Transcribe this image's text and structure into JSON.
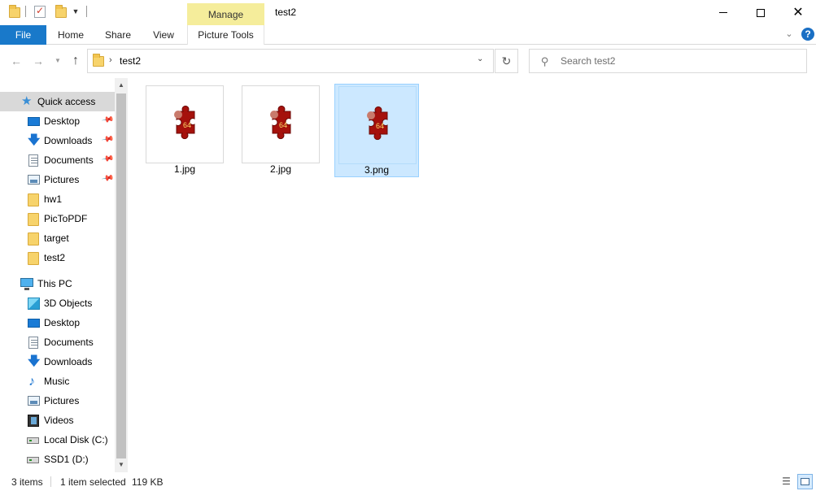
{
  "window": {
    "title": "test2",
    "context_tab_group": "Manage",
    "min_icon": "minimize-icon",
    "max_icon": "maximize-icon",
    "close_icon": "close-icon",
    "close_glyph": "✕"
  },
  "ribbon": {
    "tabs": [
      {
        "label": "File"
      },
      {
        "label": "Home"
      },
      {
        "label": "Share"
      },
      {
        "label": "View"
      },
      {
        "label": "Picture Tools"
      }
    ],
    "expand_glyph": "⌄",
    "help_glyph": "?"
  },
  "nav": {
    "back_glyph": "←",
    "forward_glyph": "→",
    "recent_glyph": "▼",
    "up_glyph": "↑"
  },
  "address": {
    "breadcrumb_separator": "›",
    "path": "test2",
    "dropdown_glyph": "⌄",
    "refresh_glyph": "↻"
  },
  "search": {
    "placeholder": "Search test2",
    "value": "",
    "icon_glyph": "⚲"
  },
  "sidebar": {
    "quick_access": {
      "label": "Quick access",
      "items": [
        {
          "label": "Desktop",
          "pinned": true
        },
        {
          "label": "Downloads",
          "pinned": true
        },
        {
          "label": "Documents",
          "pinned": true
        },
        {
          "label": "Pictures",
          "pinned": true
        },
        {
          "label": "hw1",
          "pinned": false
        },
        {
          "label": "PicToPDF",
          "pinned": false
        },
        {
          "label": "target",
          "pinned": false
        },
        {
          "label": "test2",
          "pinned": false
        }
      ]
    },
    "this_pc": {
      "label": "This PC",
      "items": [
        {
          "label": "3D Objects"
        },
        {
          "label": "Desktop"
        },
        {
          "label": "Documents"
        },
        {
          "label": "Downloads"
        },
        {
          "label": "Music"
        },
        {
          "label": "Pictures"
        },
        {
          "label": "Videos"
        },
        {
          "label": "Local Disk (C:)"
        },
        {
          "label": "SSD1 (D:)"
        }
      ]
    },
    "pin_glyph": "📌",
    "scroll_up_glyph": "▲",
    "scroll_down_glyph": "▼"
  },
  "files": [
    {
      "name": "1.jpg",
      "selected": false,
      "badge": "64"
    },
    {
      "name": "2.jpg",
      "selected": false,
      "badge": "64"
    },
    {
      "name": "3.png",
      "selected": true,
      "badge": "64"
    }
  ],
  "status": {
    "item_count": "3 items",
    "selection": "1 item selected",
    "selection_size": "119 KB",
    "details_view_glyph": "☰"
  },
  "colors": {
    "file_tab": "#1979ca",
    "manage_tab": "#f5ed9b",
    "selection_fill": "#cce8ff",
    "selection_border": "#99d1ff",
    "puzzle": "#a5110c"
  }
}
